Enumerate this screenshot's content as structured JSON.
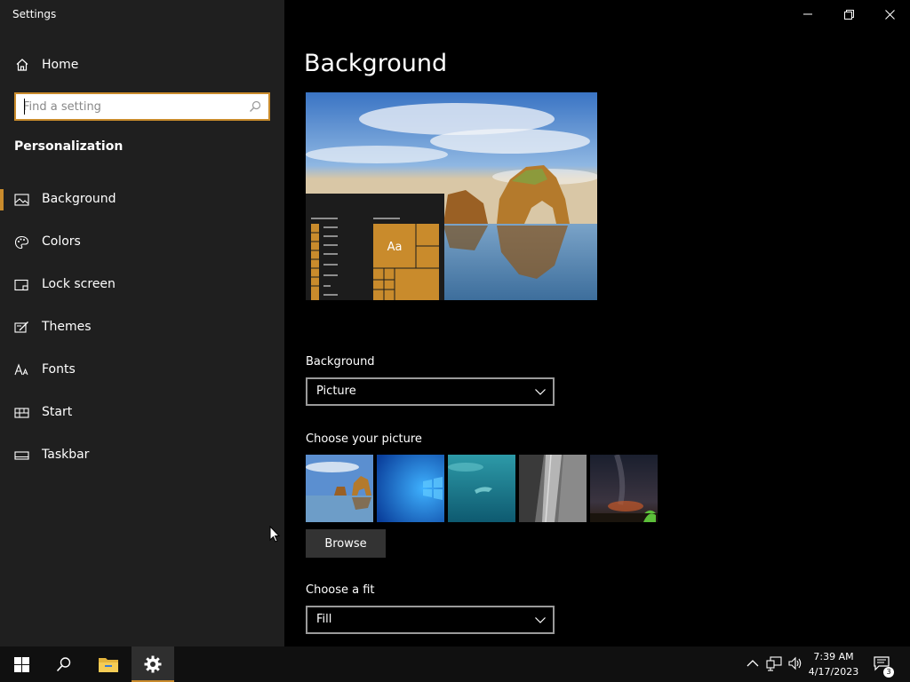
{
  "window": {
    "title": "Settings",
    "minimize_icon": "minimize-icon",
    "restore_icon": "restore-icon",
    "close_icon": "close-icon"
  },
  "sidebar": {
    "home_label": "Home",
    "search_placeholder": "Find a setting",
    "section_title": "Personalization",
    "items": [
      {
        "label": "Background",
        "icon": "image-icon",
        "active": true
      },
      {
        "label": "Colors",
        "icon": "palette-icon",
        "active": false
      },
      {
        "label": "Lock screen",
        "icon": "lock-screen-icon",
        "active": false
      },
      {
        "label": "Themes",
        "icon": "themes-icon",
        "active": false
      },
      {
        "label": "Fonts",
        "icon": "fonts-icon",
        "active": false
      },
      {
        "label": "Start",
        "icon": "start-icon",
        "active": false
      },
      {
        "label": "Taskbar",
        "icon": "taskbar-icon",
        "active": false
      }
    ]
  },
  "main": {
    "title": "Background",
    "preview_tile_text": "Aa",
    "background_label": "Background",
    "background_value": "Picture",
    "choose_picture_label": "Choose your picture",
    "browse_label": "Browse",
    "choose_fit_label": "Choose a fit",
    "fit_value": "Fill"
  },
  "taskbar": {
    "time": "7:39 AM",
    "date": "4/17/2023",
    "notification_count": "3"
  },
  "colors": {
    "accent": "#c98b2c",
    "sidebar_bg": "#1f1f1f",
    "main_bg": "#000000",
    "taskbar_bg": "#101010"
  }
}
